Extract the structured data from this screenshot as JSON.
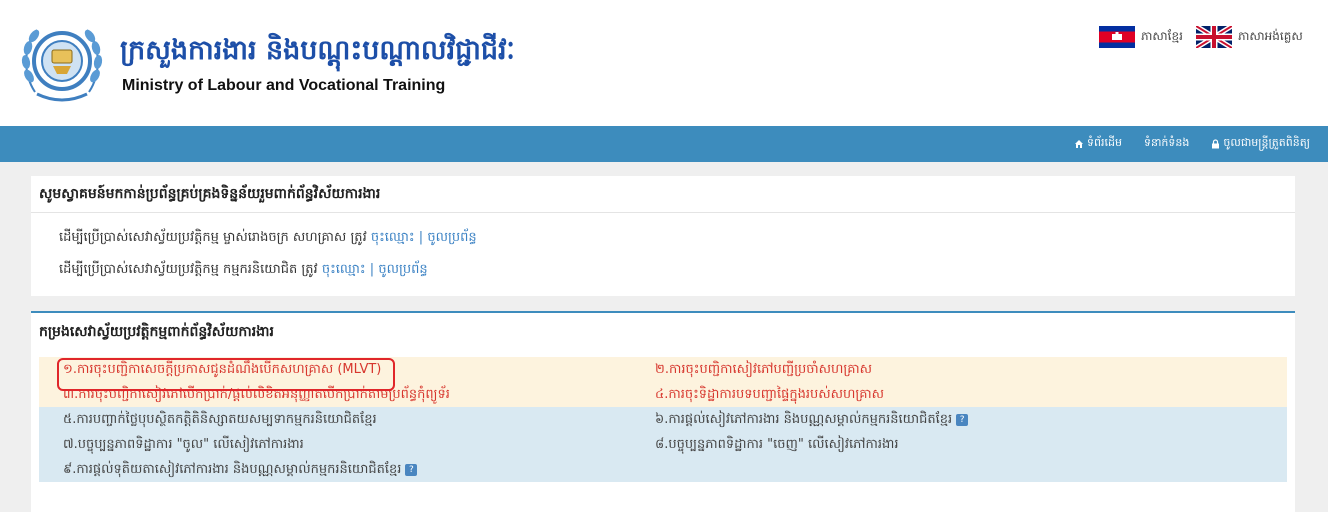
{
  "header": {
    "title_km": "ក្រសួងការងារ និងបណ្តុះបណ្តាលវិជ្ជាជីវៈ",
    "title_en": "Ministry of Labour and Vocational Training"
  },
  "languages": [
    {
      "label": "ភាសាខ្មែរ",
      "flag": "cambodia-flag-icon"
    },
    {
      "label": "ភាសាអង់គ្លេស",
      "flag": "uk-flag-icon"
    }
  ],
  "nav": {
    "home": "ទំព័រដើម",
    "contact": "ទំនាក់ទំនង",
    "login": "ចូលជាមន្ត្រីត្រួតពិនិត្យ"
  },
  "notice": {
    "heading": "សូមស្វាគមន៍មកកាន់ប្រព័ន្ធគ្រប់គ្រងទិន្នន័យរួមពាក់ព័ន្ធវិស័យការងារ",
    "lines": [
      {
        "text": "ដើម្បីប្រើប្រាស់សេវាស្វ័យប្រវត្តិកម្ម ម្ចាស់រោងចក្រ សហគ្រាស ត្រូវ",
        "register": "ចុះឈ្មោះ",
        "separator": "|",
        "login": "ចូលប្រព័ន្ធ"
      },
      {
        "text": "ដើម្បីប្រើប្រាស់សេវាស្វ័យប្រវត្តិកម្ម កម្មករនិយោជិត ត្រូវ",
        "register": "ចុះឈ្មោះ",
        "separator": "|",
        "login": "ចូលប្រព័ន្ធ"
      }
    ]
  },
  "services": {
    "heading": "កម្រងសេវាស្វ័យប្រវត្តិកម្មពាក់ព័ន្ធវិស័យការងារ",
    "help_glyph": "?",
    "rows": [
      {
        "left": "១.ការចុះបញ្ជិកាសេចក្តីប្រកាសជូនដំណឹងបើកសហគ្រាស (MLVT)",
        "right": "២.ការចុះបញ្ជិកាសៀវភៅបញ្ជីប្រចាំសហគ្រាស"
      },
      {
        "left": "៣.ការចុះបញ្ជិកាសៀវភៅបើកប្រាក់/ផ្តល់លិខិតអនុញ្ញាតបើកប្រាក់តាមប្រព័ន្ធកុំព្យូទ័រ",
        "right": "៤.ការចុះទិដ្ឋាការបទបញ្ជាផ្ទៃក្នុងរបស់សហគ្រាស"
      },
      {
        "left": "៥.ការបញ្ចាក់ថ្លៃបុបស្ថិតកត្តិតិនិស្សាតយសម្បទាកម្មករនិយោជិតខ្មែរ",
        "right": "៦.ការផ្តល់សៀវភៅការងារ និងបណ្ណសម្គាល់កម្មករនិយោជិតខ្មែរ",
        "right_help": true
      },
      {
        "left": "៧.បច្ចុប្បន្នភាពទិដ្ឋាការ \"ចូល\" លើសៀវភៅការងារ",
        "right": "៨.បច្ចុប្បន្នភាពទិដ្ឋាការ \"ចេញ\" លើសៀវភៅការងារ"
      },
      {
        "left": "៩.ការផ្តល់ទុតិយតាសៀវភៅការងារ និងបណ្ណសម្គាល់កម្មករនិយោជិតខ្មែរ",
        "left_help": true,
        "right": ""
      }
    ]
  }
}
